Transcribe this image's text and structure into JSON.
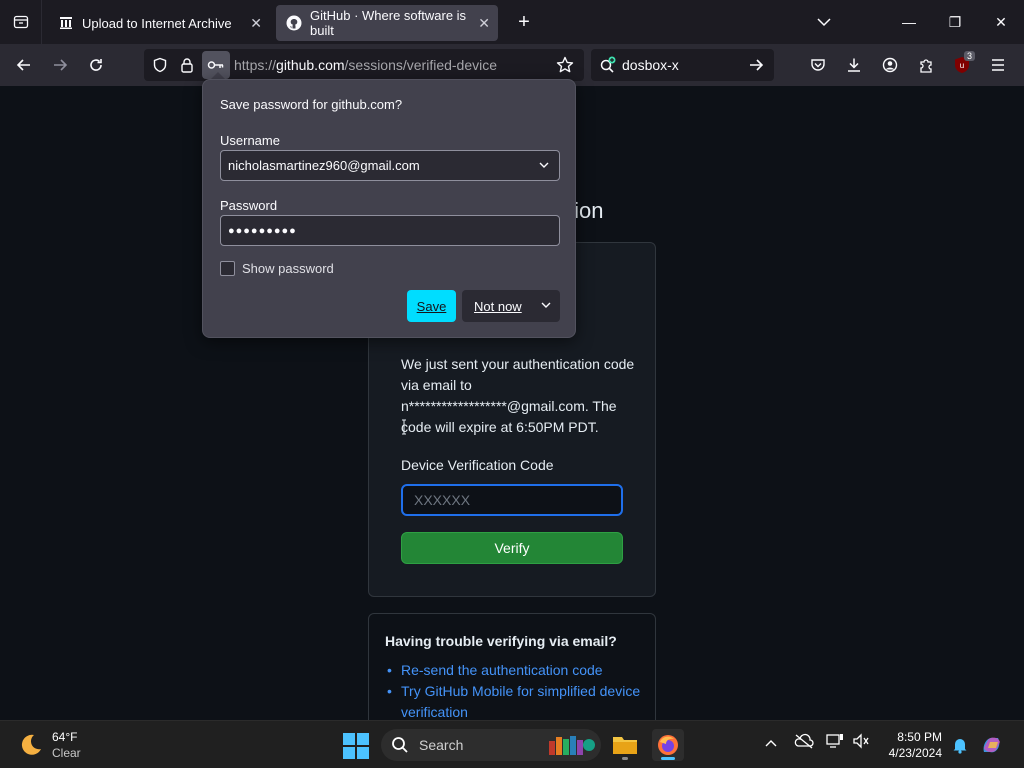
{
  "browser": {
    "tabs": [
      {
        "title": "Upload to Internet Archive",
        "active": false,
        "favicon": "archive-icon"
      },
      {
        "title": "GitHub · Where software is built",
        "active": true,
        "favicon": "github-icon"
      }
    ],
    "url": {
      "prefix": "https://",
      "host": "github.com",
      "path": "/sessions/verified-device"
    },
    "search_query": "dosbox-x",
    "extension_badge": "3",
    "accent_color": "#00ddff"
  },
  "save_password_popup": {
    "title": "Save password for github.com?",
    "username_label": "Username",
    "username_value": "nicholasmartinez960@gmail.com",
    "password_label": "Password",
    "password_value": "●●●●●●●●●",
    "show_password_label": "Show password",
    "show_password_checked": false,
    "save_label": "Save",
    "not_now_label": "Not now"
  },
  "page": {
    "title_partial": "tion",
    "message": "We just sent your authentication code via email to n******************@gmail.com. The code will expire at 6:50PM PDT.",
    "code_label": "Device Verification Code",
    "code_placeholder": "XXXXXX",
    "verify_label": "Verify",
    "help": {
      "title": "Having trouble verifying via email?",
      "links": [
        "Re-send the authentication code",
        "Try GitHub Mobile for simplified device verification"
      ]
    }
  },
  "taskbar": {
    "weather_temp": "64°F",
    "weather_desc": "Clear",
    "search_label": "Search",
    "time": "8:50 PM",
    "date": "4/23/2024"
  }
}
